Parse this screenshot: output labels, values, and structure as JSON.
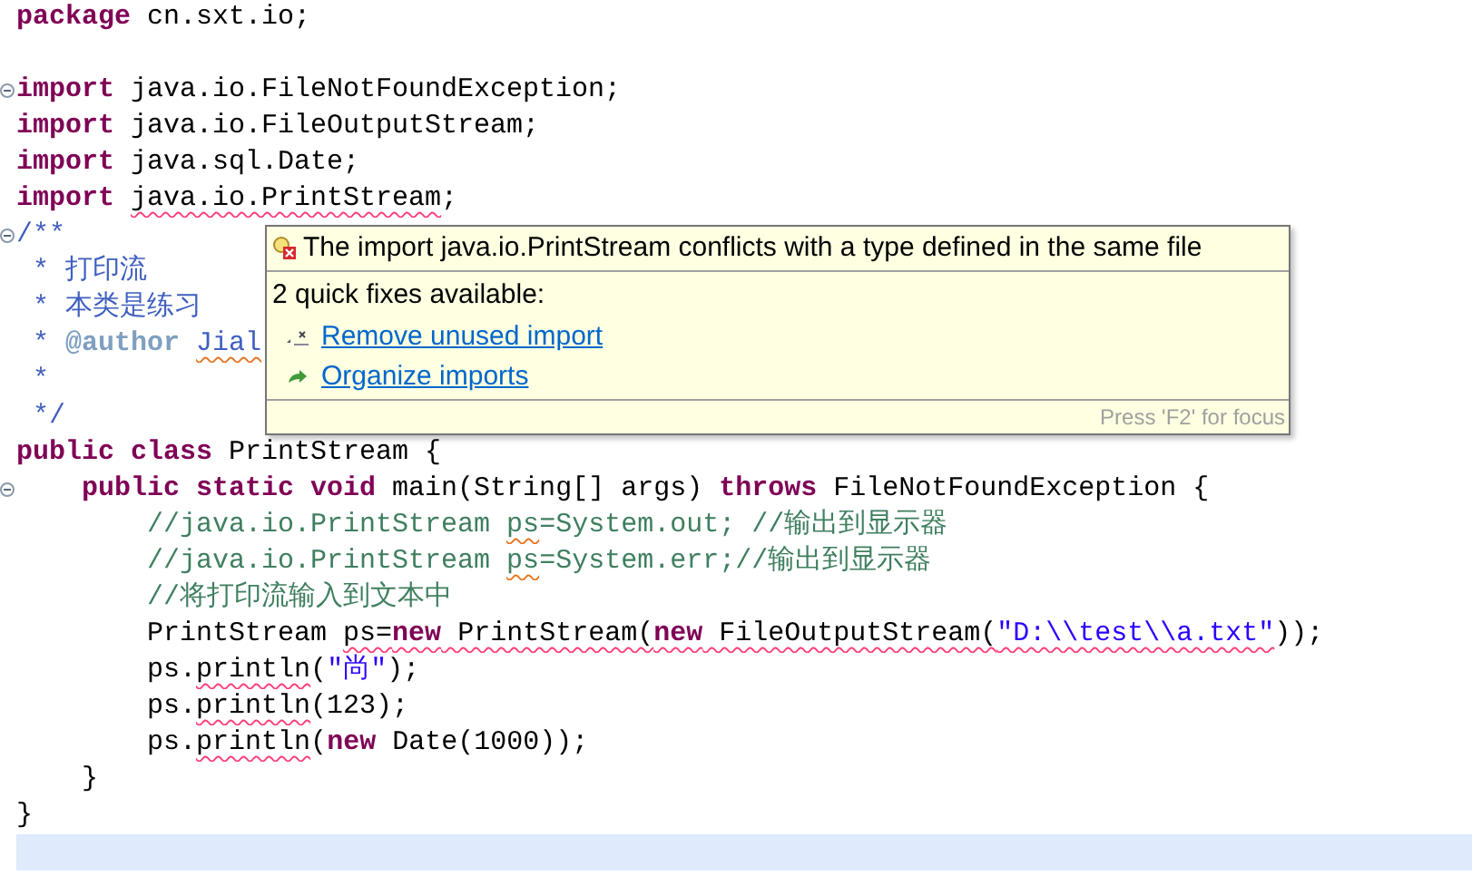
{
  "editor": {
    "lines": [
      {
        "fold": false,
        "current": false,
        "tokens": [
          {
            "kind": "keyword",
            "text": "package",
            "error": false,
            "misspelled": false
          },
          {
            "kind": "plain",
            "text": " cn.sxt.io;",
            "error": false,
            "misspelled": false
          }
        ]
      },
      {
        "fold": false,
        "current": false
      },
      {
        "fold": true,
        "current": false,
        "tokens": [
          {
            "kind": "keyword",
            "text": "import",
            "error": false,
            "misspelled": false
          },
          {
            "kind": "plain",
            "text": " java.io.FileNotFoundException;",
            "error": false,
            "misspelled": false
          }
        ]
      },
      {
        "fold": false,
        "current": false,
        "tokens": [
          {
            "kind": "keyword",
            "text": "import",
            "error": false,
            "misspelled": false
          },
          {
            "kind": "plain",
            "text": " java.io.FileOutputStream;",
            "error": false,
            "misspelled": false
          }
        ]
      },
      {
        "fold": false,
        "current": false,
        "tokens": [
          {
            "kind": "keyword",
            "text": "import",
            "error": false,
            "misspelled": false
          },
          {
            "kind": "plain",
            "text": " java.sql.Date;",
            "error": false,
            "misspelled": false
          }
        ]
      },
      {
        "fold": false,
        "current": false,
        "tokens": [
          {
            "kind": "keyword",
            "text": "import ",
            "error": false,
            "misspelled": false
          },
          {
            "kind": "plain",
            "text": "java.io.PrintStream",
            "error": true,
            "misspelled": false
          },
          {
            "kind": "plain",
            "text": ";",
            "error": false,
            "misspelled": false
          }
        ]
      },
      {
        "fold": true,
        "current": false,
        "tokens": [
          {
            "kind": "javadoc",
            "text": "/**",
            "error": false,
            "misspelled": false
          }
        ]
      },
      {
        "fold": false,
        "current": false,
        "tokens": [
          {
            "kind": "javadoc",
            "text": " * 打印流",
            "error": false,
            "misspelled": false
          }
        ]
      },
      {
        "fold": false,
        "current": false,
        "tokens": [
          {
            "kind": "javadoc",
            "text": " * 本类是练习",
            "error": false,
            "misspelled": false
          }
        ]
      },
      {
        "fold": false,
        "current": false,
        "tokens": [
          {
            "kind": "javadoc",
            "text": " * ",
            "error": false,
            "misspelled": false
          },
          {
            "kind": "tag",
            "text": "@author ",
            "error": false,
            "misspelled": false
          },
          {
            "kind": "javadoc",
            "text": "Jial",
            "error": false,
            "misspelled": true
          }
        ]
      },
      {
        "fold": false,
        "current": false,
        "tokens": [
          {
            "kind": "javadoc",
            "text": " *",
            "error": false,
            "misspelled": false
          }
        ]
      },
      {
        "fold": false,
        "current": false,
        "tokens": [
          {
            "kind": "javadoc",
            "text": " */",
            "error": false,
            "misspelled": false
          }
        ]
      },
      {
        "fold": false,
        "current": false,
        "tokens": [
          {
            "kind": "keyword",
            "text": "public class ",
            "error": false,
            "misspelled": false
          },
          {
            "kind": "plain",
            "text": "PrintStream {",
            "error": false,
            "misspelled": false
          }
        ]
      },
      {
        "fold": true,
        "current": false,
        "tokens": [
          {
            "kind": "keyword",
            "text": "    public static void",
            "error": false,
            "misspelled": false
          },
          {
            "kind": "plain",
            "text": " main(String[] args) ",
            "error": false,
            "misspelled": false
          },
          {
            "kind": "keyword",
            "text": "throws",
            "error": false,
            "misspelled": false
          },
          {
            "kind": "plain",
            "text": " FileNotFoundException {",
            "error": false,
            "misspelled": false
          }
        ]
      },
      {
        "fold": false,
        "current": false,
        "tokens": [
          {
            "kind": "comment",
            "text": "        //java.io.PrintStream ",
            "error": false,
            "misspelled": false
          },
          {
            "kind": "comment",
            "text": "ps",
            "error": false,
            "misspelled": true
          },
          {
            "kind": "comment",
            "text": "=System.out; //输出到显示器",
            "error": false,
            "misspelled": false
          }
        ]
      },
      {
        "fold": false,
        "current": false,
        "tokens": [
          {
            "kind": "comment",
            "text": "        //java.io.PrintStream ",
            "error": false,
            "misspelled": false
          },
          {
            "kind": "comment",
            "text": "ps",
            "error": false,
            "misspelled": true
          },
          {
            "kind": "comment",
            "text": "=System.err;//输出到显示器",
            "error": false,
            "misspelled": false
          }
        ]
      },
      {
        "fold": false,
        "current": false,
        "tokens": [
          {
            "kind": "comment",
            "text": "        //将打印流输入到文本中",
            "error": false,
            "misspelled": false
          }
        ]
      },
      {
        "fold": false,
        "current": false,
        "tokens": [
          {
            "kind": "plain",
            "text": "        PrintStream ",
            "error": false,
            "misspelled": false
          },
          {
            "kind": "plain",
            "text": "ps=",
            "error": true,
            "misspelled": false
          },
          {
            "kind": "keyword",
            "text": "new",
            "error": true,
            "misspelled": false
          },
          {
            "kind": "plain",
            "text": " PrintStream(",
            "error": true,
            "misspelled": false
          },
          {
            "kind": "keyword",
            "text": "new",
            "error": true,
            "misspelled": false
          },
          {
            "kind": "plain",
            "text": " FileOutputStream(",
            "error": true,
            "misspelled": false
          },
          {
            "kind": "string",
            "text": "\"D:\\\\test\\\\a.txt\"",
            "error": true,
            "misspelled": false
          },
          {
            "kind": "plain",
            "text": "));",
            "error": false,
            "misspelled": false
          }
        ]
      },
      {
        "fold": false,
        "current": false,
        "tokens": [
          {
            "kind": "plain",
            "text": "        ps.",
            "error": false,
            "misspelled": false
          },
          {
            "kind": "plain",
            "text": "println",
            "error": true,
            "misspelled": false
          },
          {
            "kind": "plain",
            "text": "(",
            "error": false,
            "misspelled": false
          },
          {
            "kind": "string",
            "text": "\"尚\"",
            "error": false,
            "misspelled": false
          },
          {
            "kind": "plain",
            "text": ");",
            "error": false,
            "misspelled": false
          }
        ]
      },
      {
        "fold": false,
        "current": false,
        "tokens": [
          {
            "kind": "plain",
            "text": "        ps.",
            "error": false,
            "misspelled": false
          },
          {
            "kind": "plain",
            "text": "println",
            "error": true,
            "misspelled": false
          },
          {
            "kind": "plain",
            "text": "(123);",
            "error": false,
            "misspelled": false
          }
        ]
      },
      {
        "fold": false,
        "current": false,
        "tokens": [
          {
            "kind": "plain",
            "text": "        ps.",
            "error": false,
            "misspelled": false
          },
          {
            "kind": "plain",
            "text": "println",
            "error": true,
            "misspelled": false
          },
          {
            "kind": "plain",
            "text": "(",
            "error": false,
            "misspelled": false
          },
          {
            "kind": "keyword",
            "text": "new",
            "error": false,
            "misspelled": false
          },
          {
            "kind": "plain",
            "text": " Date(1000));",
            "error": false,
            "misspelled": false
          }
        ]
      },
      {
        "fold": false,
        "current": false,
        "tokens": [
          {
            "kind": "plain",
            "text": "    }",
            "error": false,
            "misspelled": false
          }
        ]
      },
      {
        "fold": false,
        "current": false,
        "tokens": [
          {
            "kind": "plain",
            "text": "}",
            "error": false,
            "misspelled": false
          }
        ]
      },
      {
        "fold": false,
        "current": true
      }
    ]
  },
  "popup": {
    "message": "The import java.io.PrintStream conflicts with a type defined in the same file",
    "summary": "2 quick fixes available:",
    "fixes": [
      {
        "kind": "remove",
        "label": "Remove unused import"
      },
      {
        "kind": "organize",
        "label": "Organize imports"
      }
    ],
    "hint": "Press 'F2' for focus"
  }
}
